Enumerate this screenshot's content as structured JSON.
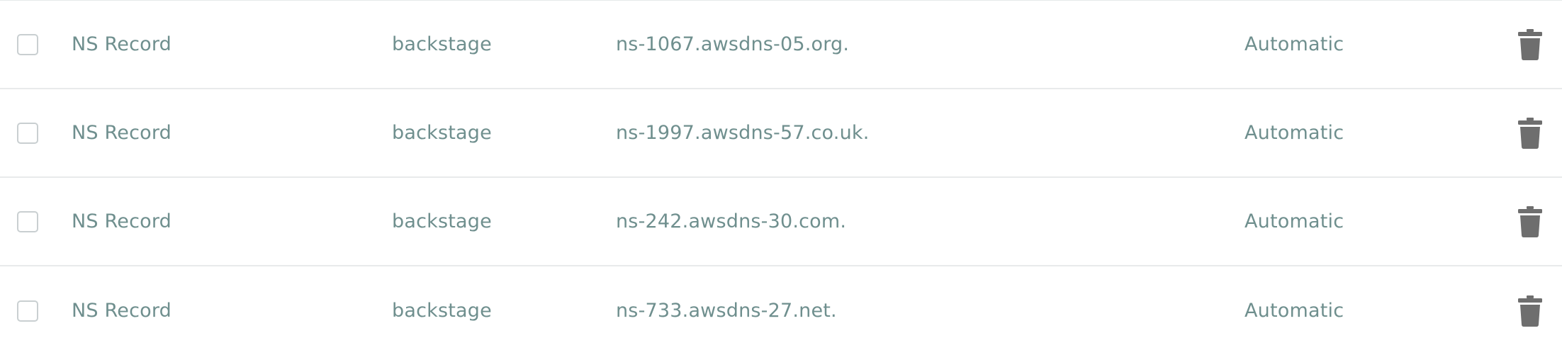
{
  "records": [
    {
      "type": "NS Record",
      "name": "backstage",
      "value": "ns-1067.awsdns-05.org.",
      "ttl": "Automatic"
    },
    {
      "type": "NS Record",
      "name": "backstage",
      "value": "ns-1997.awsdns-57.co.uk.",
      "ttl": "Automatic"
    },
    {
      "type": "NS Record",
      "name": "backstage",
      "value": "ns-242.awsdns-30.com.",
      "ttl": "Automatic"
    },
    {
      "type": "NS Record",
      "name": "backstage",
      "value": "ns-733.awsdns-27.net.",
      "ttl": "Automatic"
    }
  ],
  "icons": {
    "select": "checkbox",
    "delete": "trash-icon"
  },
  "colors": {
    "text": "#6f8f8e",
    "icon": "#6e6e6e",
    "divider": "#e8eaeb",
    "checkbox_border": "#c9cfd1"
  }
}
